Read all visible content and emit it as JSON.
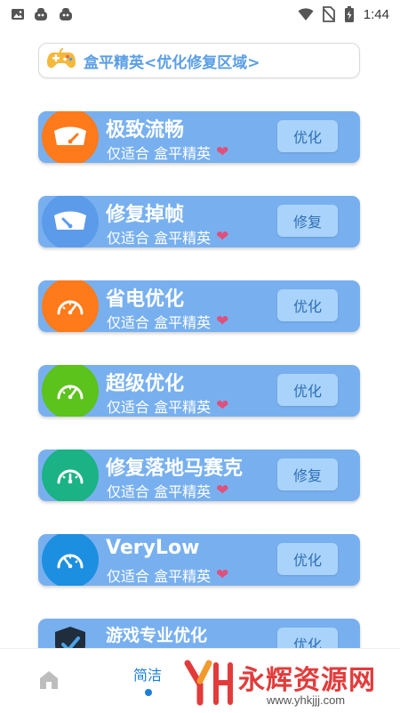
{
  "status_bar": {
    "time": "1:44",
    "battery": "5"
  },
  "header": {
    "title": "盒平精英<优化修复区域>"
  },
  "cards": [
    {
      "title": "极致流畅",
      "subtitle": "仅适合 盒平精英",
      "button": "优化",
      "icon": "speedometer-icon",
      "color": "#ff7a1a"
    },
    {
      "title": "修复掉帧",
      "subtitle": "仅适合 盒平精英",
      "button": "修复",
      "icon": "speedometer-icon",
      "color": "#5b9bea"
    },
    {
      "title": "省电优化",
      "subtitle": "仅适合 盒平精英",
      "button": "优化",
      "icon": "gauge-icon",
      "color": "#ff7a1a"
    },
    {
      "title": "超级优化",
      "subtitle": "仅适合 盒平精英",
      "button": "优化",
      "icon": "gauge-icon",
      "color": "#5cc21c"
    },
    {
      "title": "修复落地马赛克",
      "subtitle": "仅适合 盒平精英",
      "button": "修复",
      "icon": "gauge-icon",
      "color": "#1bb285"
    },
    {
      "title": "VeryLow",
      "subtitle": "仅适合 盒平精英",
      "button": "优化",
      "icon": "gauge-icon",
      "color": "#1d8fe0"
    },
    {
      "title": "游戏专业优化",
      "subtitle": "",
      "button": "优化",
      "icon": "shield-icon",
      "color": "#1f2d3d"
    }
  ],
  "bottom_nav": {
    "tab_label": "简洁",
    "watermark": "永辉资源网",
    "watermark_url": "www.yhkjjj.com"
  }
}
